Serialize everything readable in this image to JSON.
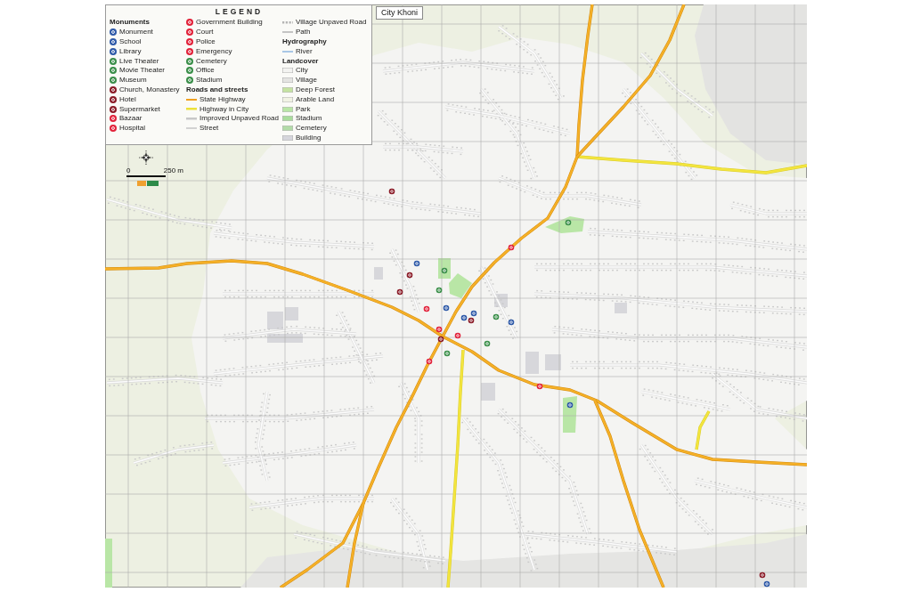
{
  "map": {
    "title": "City Khoni"
  },
  "legend": {
    "title": "LEGEND",
    "columns": [
      {
        "groups": [
          {
            "heading": "Monuments",
            "items": [
              {
                "label": "Monument",
                "kind": "marker",
                "color": "#2f5aa8"
              },
              {
                "label": "School",
                "kind": "marker",
                "color": "#2f5aa8"
              },
              {
                "label": "Library",
                "kind": "marker",
                "color": "#2f5aa8"
              },
              {
                "label": "Live Theater",
                "kind": "marker",
                "color": "#3b8f4a"
              },
              {
                "label": "Movie Theater",
                "kind": "marker",
                "color": "#3b8f4a"
              },
              {
                "label": "Museum",
                "kind": "marker",
                "color": "#3b8f4a"
              },
              {
                "label": "Church, Monastery",
                "kind": "marker",
                "color": "#8b1c28"
              },
              {
                "label": "Hotel",
                "kind": "marker",
                "color": "#8b1c28"
              },
              {
                "label": "Supermarket",
                "kind": "marker",
                "color": "#8b1c28"
              },
              {
                "label": "Bazaar",
                "kind": "marker",
                "color": "#e2233b"
              },
              {
                "label": "Hospital",
                "kind": "marker",
                "color": "#e2233b"
              }
            ]
          }
        ]
      },
      {
        "groups": [
          {
            "items": [
              {
                "label": "Government Building",
                "kind": "marker",
                "color": "#e2233b"
              },
              {
                "label": "Court",
                "kind": "marker",
                "color": "#e2233b"
              },
              {
                "label": "Police",
                "kind": "marker",
                "color": "#e2233b"
              },
              {
                "label": "Emergency",
                "kind": "marker",
                "color": "#e2233b"
              },
              {
                "label": "Cemetery",
                "kind": "marker",
                "color": "#3b8f4a"
              },
              {
                "label": "Office",
                "kind": "marker",
                "color": "#3b8f4a"
              },
              {
                "label": "Stadium",
                "kind": "marker",
                "color": "#3b8f4a"
              }
            ]
          },
          {
            "heading": "Roads and streets",
            "items": [
              {
                "label": "State Highway",
                "kind": "line",
                "color": "#f0a020"
              },
              {
                "label": "Highway in City",
                "kind": "line",
                "color": "#ece13a"
              },
              {
                "label": "Improved Unpaved Road",
                "kind": "line",
                "color": "#c8c8c8"
              },
              {
                "label": "Street",
                "kind": "line",
                "color": "#d2d2d2"
              }
            ]
          }
        ]
      },
      {
        "groups": [
          {
            "items": [
              {
                "label": "Village Unpaved Road",
                "kind": "dashed",
                "color": "#b4b4b4"
              },
              {
                "label": "Path",
                "kind": "line",
                "color": "#c4c4c4"
              }
            ]
          },
          {
            "heading": "Hydrography",
            "items": [
              {
                "label": "River",
                "kind": "line",
                "color": "#a9c7e6"
              }
            ]
          },
          {
            "heading": "Landcover",
            "items": [
              {
                "label": "City",
                "kind": "area",
                "color": "#f3f3f1"
              },
              {
                "label": "Village",
                "kind": "area",
                "color": "#e4e4e2"
              },
              {
                "label": "Deep Forest",
                "kind": "area",
                "color": "#c5e3a2"
              },
              {
                "label": "Arable Land",
                "kind": "area",
                "color": "#f1f3e4"
              },
              {
                "label": "Park",
                "kind": "area",
                "color": "#b9e6a6"
              },
              {
                "label": "Stadium",
                "kind": "area",
                "color": "#a9dd9c"
              },
              {
                "label": "Cemetery",
                "kind": "area",
                "color": "#b2dba8"
              },
              {
                "label": "Building",
                "kind": "area",
                "color": "#d6d6dc"
              }
            ]
          }
        ]
      }
    ]
  },
  "scale": {
    "start": "0",
    "end": "250 m"
  },
  "markers": [
    {
      "color": "#8b1c28"
    },
    {
      "color": "#e2233b"
    },
    {
      "color": "#2f5aa8"
    },
    {
      "color": "#3b8f4a"
    },
    {
      "color": "#8b1c28"
    },
    {
      "color": "#8b1c28"
    },
    {
      "color": "#3b8f4a"
    },
    {
      "color": "#e2233b"
    },
    {
      "color": "#2f5aa8"
    },
    {
      "color": "#2f5aa8"
    },
    {
      "color": "#2f5aa8"
    },
    {
      "color": "#8b1c28"
    },
    {
      "color": "#3b8f4a"
    },
    {
      "color": "#2f5aa8"
    },
    {
      "color": "#e2233b"
    },
    {
      "color": "#e2233b"
    },
    {
      "color": "#8b1c28"
    },
    {
      "color": "#3b8f4a"
    },
    {
      "color": "#3b8f4a"
    },
    {
      "color": "#e2233b"
    },
    {
      "color": "#e2233b"
    },
    {
      "color": "#2f5aa8"
    },
    {
      "color": "#3b8f4a"
    },
    {
      "color": "#8b1c28"
    },
    {
      "color": "#2f5aa8"
    }
  ]
}
